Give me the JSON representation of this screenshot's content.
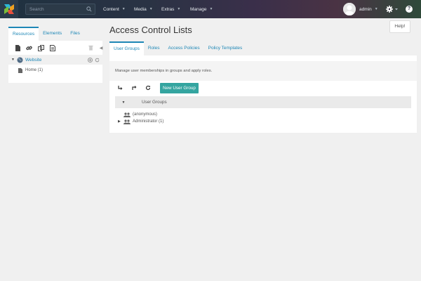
{
  "topbar": {
    "search_placeholder": "Search",
    "nav": [
      "Content",
      "Media",
      "Extras",
      "Manage"
    ],
    "user": "admin"
  },
  "left_panel": {
    "tabs": [
      "Resources",
      "Elements",
      "Files"
    ],
    "active_tab": "Resources",
    "tree": {
      "root": "Website",
      "children": [
        "Home (1)"
      ]
    }
  },
  "main": {
    "title": "Access Control Lists",
    "help_label": "Help!",
    "tabs": [
      "User Groups",
      "Roles",
      "Access Policies",
      "Policy Templates"
    ],
    "active_tab": "User Groups",
    "description": "Manage user memberships in groups and apply roles.",
    "new_button": "New User Group",
    "grid_header": "User Groups",
    "groups": [
      "(anonymous)",
      "Administrator (1)"
    ]
  },
  "colors": {
    "accent": "#1e87b6",
    "button": "#34a5a0"
  }
}
